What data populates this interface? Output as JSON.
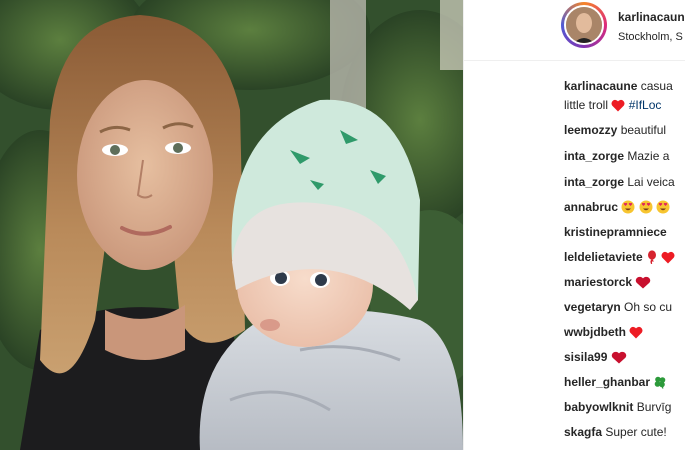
{
  "post": {
    "owner": {
      "username": "karlinacaune",
      "location": "Stockholm, S"
    },
    "caption": {
      "username": "karlinacaune",
      "line1": "casua",
      "line2_text": "little troll",
      "hashtag": "#IfLoc"
    }
  },
  "comments": [
    {
      "username": "leemozzy",
      "text": "beautiful"
    },
    {
      "username": "inta_zorge",
      "text": "Mazie a"
    },
    {
      "username": "inta_zorge",
      "text": "Lai veica"
    },
    {
      "username": "annabruc",
      "text": ""
    },
    {
      "username": "kristinepramniece",
      "text": ""
    },
    {
      "username": "leldelietaviete",
      "text": ""
    },
    {
      "username": "mariestorck",
      "text": ""
    },
    {
      "username": "vegetaryn",
      "text": "Oh so cu"
    },
    {
      "username": "wwbjdbeth",
      "text": ""
    },
    {
      "username": "sisila99",
      "text": ""
    },
    {
      "username": "heller_ghanbar",
      "text": ""
    },
    {
      "username": "babyowlknit",
      "text": "Burvīg"
    },
    {
      "username": "skagfa",
      "text": "Super cute!"
    }
  ],
  "icons": {
    "heart": "heart-icon",
    "heart_eyes": "heart-eyes-emoji-icon",
    "clover": "four-leaf-clover-icon",
    "balloon": "balloon-icon"
  },
  "colors": {
    "text": "#262626",
    "hashtag": "#003569",
    "heart": "#ed1c24",
    "border": "#efefef"
  }
}
